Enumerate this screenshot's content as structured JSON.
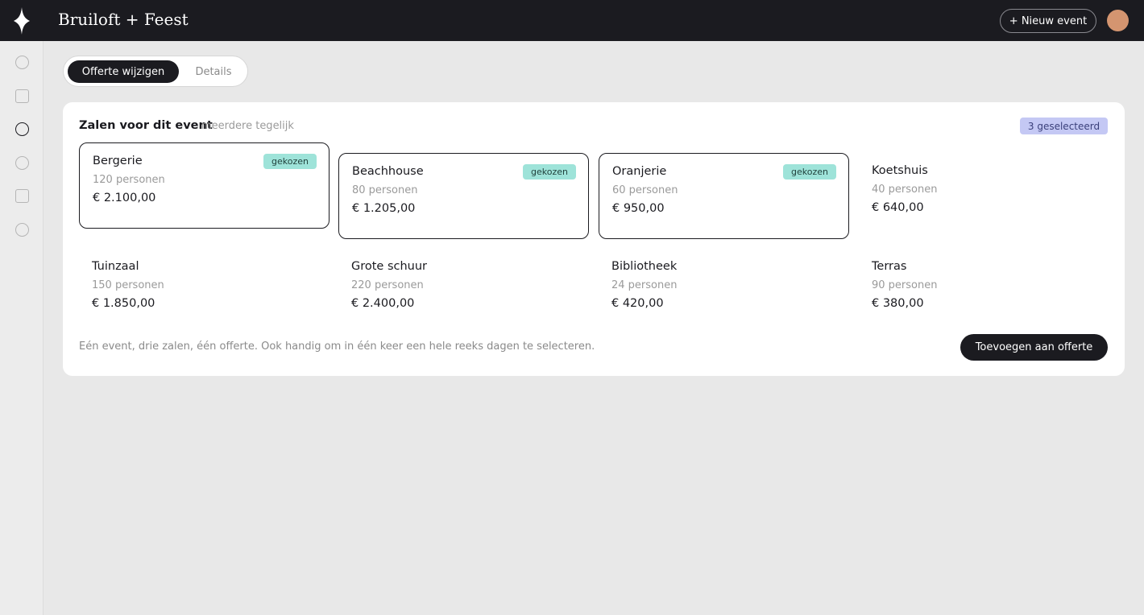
{
  "app": {
    "brand": "Bruiloft + Feest"
  },
  "header": {
    "new_event_label": "+ Nieuw event"
  },
  "tabs": [
    {
      "label": "Offerte wijzigen",
      "active": true
    },
    {
      "label": "Details",
      "active": false
    }
  ],
  "panel": {
    "title": "Zalen voor dit event",
    "hint": "meerdere tegelijk",
    "selected_count": "3 geselecteerd",
    "footer_text": "Eén event, drie zalen, één offerte. Ook handig om in één keer een hele reeks dagen te selecteren.",
    "add_button_label": "Toevoegen aan offerte"
  },
  "badge_label": "gekozen",
  "rooms": [
    {
      "name": "Bergerie",
      "capacity": "120 personen",
      "price": "€ 2.100,00",
      "selected": true
    },
    {
      "name": "Beachhouse",
      "capacity": "80 personen",
      "price": "€ 1.205,00",
      "selected": true
    },
    {
      "name": "Oranjerie",
      "capacity": "60 personen",
      "price": "€ 950,00",
      "selected": true
    },
    {
      "name": "Koetshuis",
      "capacity": "40 personen",
      "price": "€ 640,00",
      "selected": false
    },
    {
      "name": "Tuinzaal",
      "capacity": "150 personen",
      "price": "€ 1.850,00",
      "selected": false
    },
    {
      "name": "Grote schuur",
      "capacity": "220 personen",
      "price": "€ 2.400,00",
      "selected": false
    },
    {
      "name": "Bibliotheek",
      "capacity": "24 personen",
      "price": "€ 420,00",
      "selected": false
    },
    {
      "name": "Terras",
      "capacity": "90 personen",
      "price": "€ 380,00",
      "selected": false
    }
  ],
  "sidebar": {
    "icons": [
      {
        "name": "nav-circle-icon",
        "active": false
      },
      {
        "name": "nav-square-icon",
        "active": false
      },
      {
        "name": "nav-circle-icon",
        "active": true
      },
      {
        "name": "nav-circle-icon",
        "active": false
      },
      {
        "name": "nav-square-icon",
        "active": false
      },
      {
        "name": "nav-circle-icon",
        "active": false
      }
    ]
  },
  "colors": {
    "dark": "#1b1b20",
    "badge_teal": "#9ee3d9",
    "badge_lavender": "#c4c8f4",
    "avatar": "#d49570"
  }
}
